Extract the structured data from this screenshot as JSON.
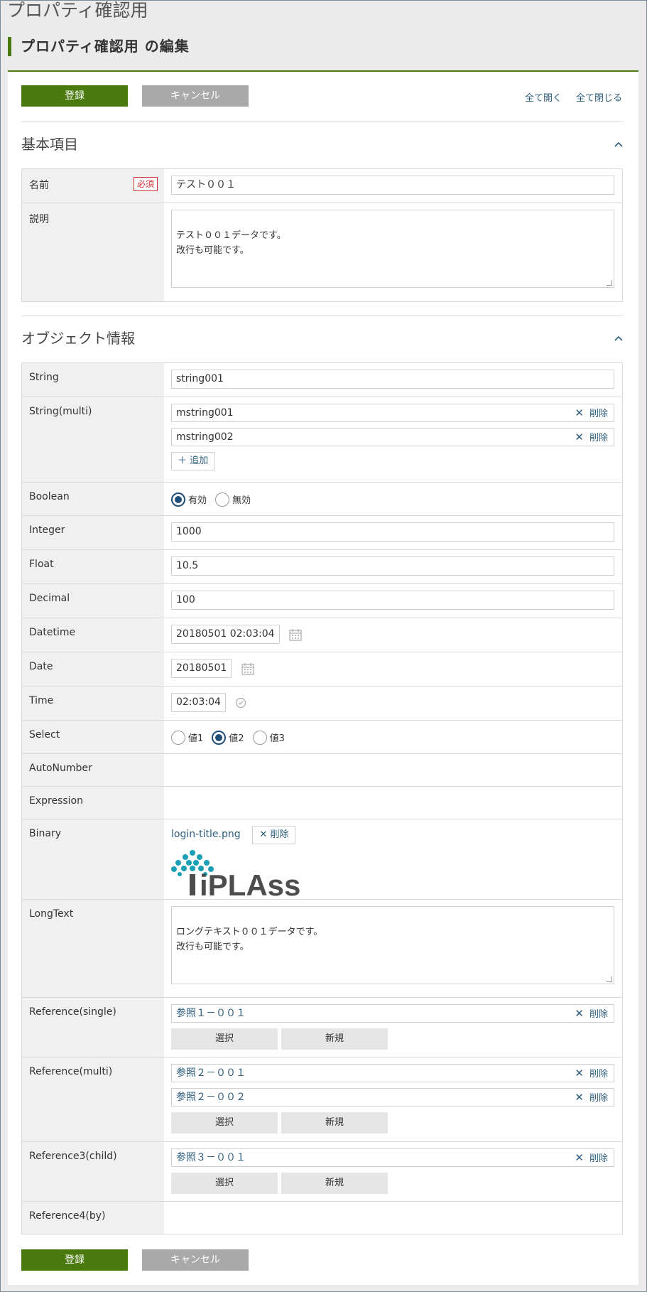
{
  "app_title": "プロパティ確認用",
  "page_heading": "プロパティ確認用 の編集",
  "toolbar": {
    "register_label": "登録",
    "cancel_label": "キャンセル",
    "expand_all": "全て開く",
    "collapse_all": "全て閉じる"
  },
  "colors": {
    "accent": "#4a7a0e",
    "link": "#2f5e7d",
    "required": "#d13438"
  },
  "basic_section": {
    "title": "基本項目",
    "name_label": "名前",
    "required_badge": "必須",
    "name_value": "テスト００１",
    "description_label": "説明",
    "description_value": "テスト００１データです。\n改行も可能です。"
  },
  "object_section": {
    "title": "オブジェクト情報",
    "string": {
      "label": "String",
      "value": "string001"
    },
    "string_multi": {
      "label": "String(multi)",
      "values": [
        "mstring001",
        "mstring002"
      ],
      "delete_label": "削除",
      "add_label": "追加"
    },
    "boolean": {
      "label": "Boolean",
      "options": [
        "有効",
        "無効"
      ],
      "selected": "有効"
    },
    "integer": {
      "label": "Integer",
      "value": "1000"
    },
    "float": {
      "label": "Float",
      "value": "10.5"
    },
    "decimal": {
      "label": "Decimal",
      "value": "100"
    },
    "datetime": {
      "label": "Datetime",
      "value": "20180501 02:03:04"
    },
    "date": {
      "label": "Date",
      "value": "20180501"
    },
    "time": {
      "label": "Time",
      "value": "02:03:04"
    },
    "select": {
      "label": "Select",
      "options": [
        "値1",
        "値2",
        "値3"
      ],
      "selected": "値2"
    },
    "autonumber": {
      "label": "AutoNumber"
    },
    "expression": {
      "label": "Expression"
    },
    "binary": {
      "label": "Binary",
      "file_name": "login-title.png",
      "delete_label": "削除",
      "logo_text": "iPLAss"
    },
    "longtext": {
      "label": "LongText",
      "value": "ロングテキスト００１データです。\n改行も可能です。"
    },
    "reference_single": {
      "label": "Reference(single)",
      "values": [
        "参照１－００１"
      ],
      "delete_label": "削除",
      "select_label": "選択",
      "new_label": "新規"
    },
    "reference_multi": {
      "label": "Reference(multi)",
      "values": [
        "参照２－００１",
        "参照２－００２"
      ],
      "delete_label": "削除",
      "select_label": "選択",
      "new_label": "新規"
    },
    "reference3_child": {
      "label": "Reference3(child)",
      "values": [
        "参照３－００１"
      ],
      "delete_label": "削除",
      "select_label": "選択",
      "new_label": "新規"
    },
    "reference4_by": {
      "label": "Reference4(by)"
    }
  }
}
